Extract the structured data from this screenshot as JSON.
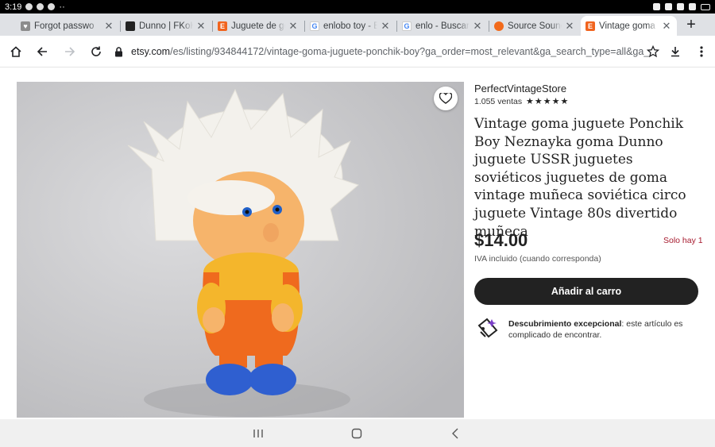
{
  "status": {
    "time": "3:19"
  },
  "tabs": [
    {
      "title": "Forgot passwo",
      "favicon": "etsy-heart-icon",
      "color": "#8c8c8c"
    },
    {
      "title": "Dunno | FKoKF",
      "favicon": "fkok-icon",
      "color": "#222222"
    },
    {
      "title": "Juguete de go",
      "favicon": "etsy-icon",
      "color": "#f1641e"
    },
    {
      "title": "enlobo toy - Bu",
      "favicon": "google-icon",
      "color": "#4285f4"
    },
    {
      "title": "enlo - Buscar c",
      "favicon": "google-icon",
      "color": "#4285f4"
    },
    {
      "title": "Source Sound",
      "favicon": "source-icon",
      "color": "#f26a1b"
    },
    {
      "title": "Vintage goma",
      "favicon": "etsy-icon",
      "color": "#f1641e"
    }
  ],
  "address": {
    "host": "etsy.com",
    "path": "/es/listing/934844172/vintage-goma-juguete-ponchik-boy?ga_order=most_relevant&ga_search_type=all&ga_"
  },
  "listing": {
    "shop": "PerfectVintageStore",
    "sales": "1.055 ventas",
    "rating_stars": 5,
    "title": "Vintage goma juguete Ponchik Boy Neznayka goma Dunno juguete USSR juguetes soviéticos juguetes de goma vintage muñeca soviética circo juguete Vintage 80s divertido muñeca",
    "price": "$14.00",
    "stock": "Solo hay 1",
    "vat": "IVA incluido (cuando corresponda)",
    "cart_label": "Añadir al carro",
    "discovery_bold": "Descubrimiento excepcional",
    "discovery_text": ": este artículo es complicado de encontrar."
  },
  "colors": {
    "accent_dark": "#222222",
    "stock_red": "#a61a2e",
    "etsy_orange": "#f1641e"
  }
}
